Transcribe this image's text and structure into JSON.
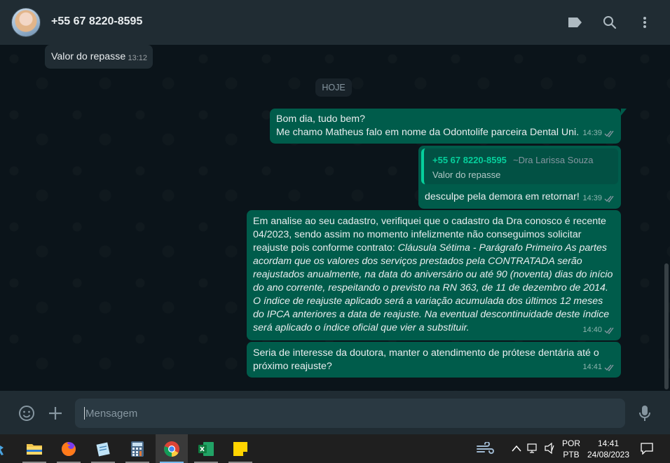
{
  "header": {
    "contact_name": "+55 67 8220-8595",
    "icons": [
      "label-icon",
      "search-icon",
      "menu-icon"
    ]
  },
  "messages": [
    {
      "direction": "incoming",
      "text": "Valor do repasse",
      "time": "13:12"
    },
    {
      "direction": "outgoing",
      "lines": [
        "Bom dia, tudo bem?",
        "Me chamo Matheus falo em nome da Odontolife parceira Dental Uni."
      ],
      "time": "14:39",
      "status": "read"
    },
    {
      "direction": "outgoing",
      "quote": {
        "author": "+55 67 8220-8595",
        "alias": "~Dra Larissa Souza",
        "text": "Valor do repasse"
      },
      "text": "desculpe pela demora em retornar!",
      "time": "14:39",
      "status": "read"
    },
    {
      "direction": "outgoing",
      "text_plain": "Em analise ao seu cadastro, verifiquei que o cadastro da Dra conosco é recente 04/2023, sendo assim no momento infelizmente não conseguimos solicitar reajuste pois conforme contrato: ",
      "text_italic": "Cláusula Sétima - Parágrafo Primeiro  As partes acordam que os valores dos serviços prestados pela CONTRATADA serão reajustados anualmente, na data do aniversário ou até 90 (noventa) dias do início do ano corrente, respeitando o previsto na RN 363, de 11 de dezembro de 2014. O índice de reajuste aplicado será a variação acumulada dos últimos 12 meses do IPCA anteriores a data de reajuste. Na eventual descontinuidade deste índice será aplicado o índice oficial que vier a substituir.",
      "time": "14:40",
      "status": "read"
    },
    {
      "direction": "outgoing",
      "text": "Seria de interesse da doutora, manter o atendimento de prótese dentária até o próximo reajuste?",
      "time": "14:41",
      "status": "read"
    }
  ],
  "date_divider": "HOJE",
  "compose": {
    "placeholder": "Mensagem",
    "value": ""
  },
  "taskbar": {
    "apps": [
      "file-explorer",
      "firefox",
      "notepad",
      "calculator",
      "chrome",
      "excel",
      "sticky-notes"
    ],
    "active_app": "chrome",
    "language": "POR",
    "layout": "PTB",
    "clock_time": "14:41",
    "clock_date": "24/08/2023"
  },
  "colors": {
    "header_bg": "#202c33",
    "chat_bg": "#0b141a",
    "incoming_bubble": "#202c33",
    "outgoing_bubble": "#005c4b",
    "accent": "#06cf9c",
    "read_tick": "#8696a0"
  }
}
